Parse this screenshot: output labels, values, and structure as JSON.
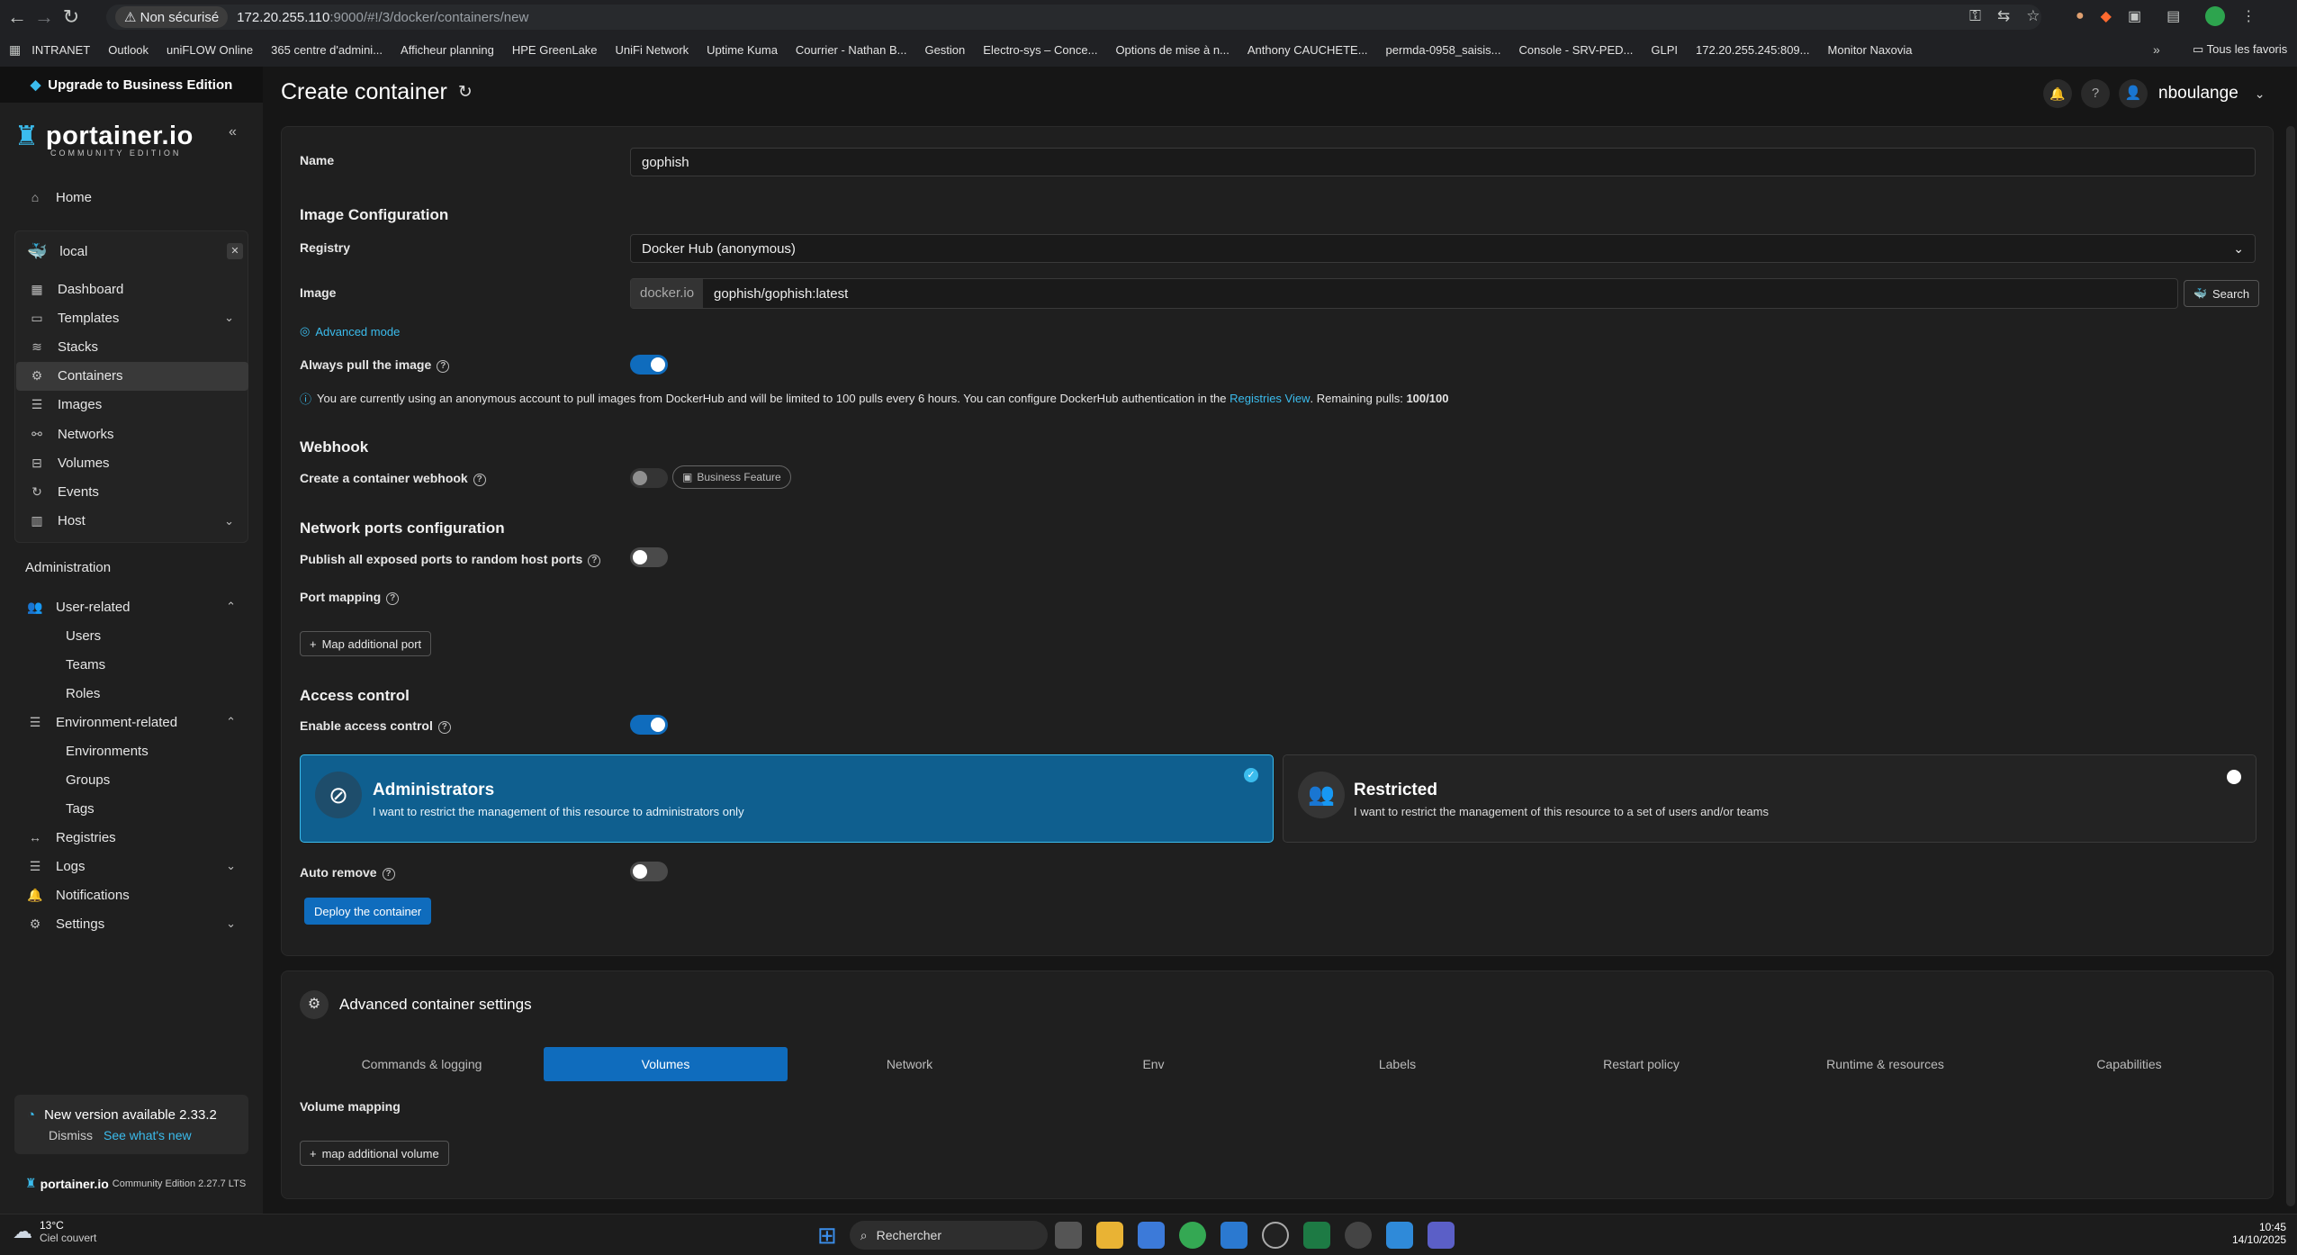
{
  "browser": {
    "security_label": "Non sécurisé",
    "url_host": "172.20.255.110",
    "url_rest": ":9000/#!/3/docker/containers/new",
    "bookmarks": [
      "INTRANET",
      "Outlook",
      "uniFLOW Online",
      "365 centre d'admini...",
      "Afficheur planning",
      "HPE GreenLake",
      "UniFi Network",
      "Uptime Kuma",
      "Courrier - Nathan B...",
      "Gestion",
      "Electro-sys – Conce...",
      "Options de mise à n...",
      "Anthony CAUCHETE...",
      "permda-0958_saisis...",
      "Console - SRV-PED...",
      "GLPI",
      "172.20.255.245:809...",
      "Monitor Naxovia"
    ],
    "all_bookmarks": "Tous les favoris"
  },
  "sidebar": {
    "upgrade": "Upgrade to Business Edition",
    "logo": "portainer.io",
    "logo_sub": "COMMUNITY EDITION",
    "home": "Home",
    "env_name": "local",
    "env_items": [
      "Dashboard",
      "Templates",
      "Stacks",
      "Containers",
      "Images",
      "Networks",
      "Volumes",
      "Events",
      "Host"
    ],
    "admin_title": "Administration",
    "user_related": "User-related",
    "user_sub": [
      "Users",
      "Teams",
      "Roles"
    ],
    "env_related": "Environment-related",
    "env_sub": [
      "Environments",
      "Groups",
      "Tags"
    ],
    "bottom_items": [
      "Registries",
      "Logs",
      "Notifications",
      "Settings"
    ],
    "new_version": "New version available 2.33.2",
    "dismiss": "Dismiss",
    "whats_new": "See what's new",
    "footer_logo": "portainer.io",
    "footer_version": "Community Edition 2.27.7 LTS"
  },
  "header": {
    "title": "Create container",
    "user": "nboulange"
  },
  "form": {
    "name_label": "Name",
    "name_value": "gophish",
    "image_config": "Image Configuration",
    "registry_label": "Registry",
    "registry_value": "Docker Hub (anonymous)",
    "image_label": "Image",
    "image_prefix": "docker.io",
    "image_value": "gophish/gophish:latest",
    "search": "Search",
    "advanced_mode": "Advanced mode",
    "always_pull": "Always pull the image",
    "info_text": "You are currently using an anonymous account to pull images from DockerHub and will be limited to 100 pulls every 6 hours. You can configure DockerHub authentication in the",
    "info_link": "Registries View",
    "info_remaining": ". Remaining pulls:",
    "info_pulls": "100/100",
    "webhook_title": "Webhook",
    "webhook_label": "Create a container webhook",
    "business_feature": "Business Feature",
    "network_title": "Network ports configuration",
    "publish_label": "Publish all exposed ports to random host ports",
    "port_mapping": "Port mapping",
    "map_port": "Map additional port",
    "access_title": "Access control",
    "enable_access": "Enable access control",
    "admins_title": "Administrators",
    "admins_desc": "I want to restrict the management of this resource to administrators only",
    "restricted_title": "Restricted",
    "restricted_desc": "I want to restrict the management of this resource to a set of users and/or teams",
    "auto_remove": "Auto remove",
    "deploy": "Deploy the container"
  },
  "advanced": {
    "title": "Advanced container settings",
    "tabs": [
      "Commands & logging",
      "Volumes",
      "Network",
      "Env",
      "Labels",
      "Restart policy",
      "Runtime & resources",
      "Capabilities"
    ],
    "volume_mapping": "Volume mapping",
    "map_volume": "map additional volume"
  },
  "taskbar": {
    "temp": "13°C",
    "weather": "Ciel couvert",
    "search": "Rechercher",
    "time": "10:45",
    "date": "14/10/2025"
  }
}
